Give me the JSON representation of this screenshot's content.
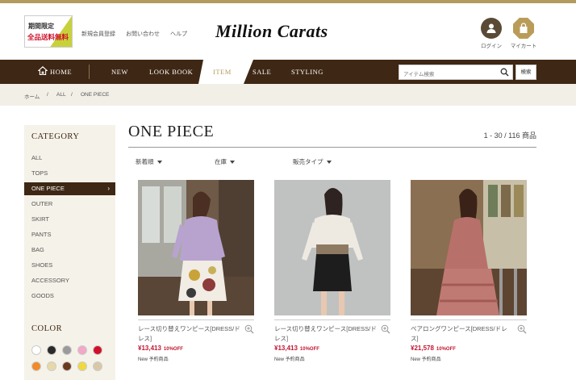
{
  "header": {
    "promo_line1": "期間限定",
    "promo_line2": "全品送料無料",
    "links": [
      "新規会員登録",
      "お問い合わせ",
      "ヘルプ"
    ],
    "logo": "Million Carats",
    "login_label": "ログイン",
    "mycart_label": "マイカート"
  },
  "nav": {
    "items": [
      "HOME",
      "NEW",
      "LOOK BOOK",
      "ITEM",
      "SALE",
      "STYLING"
    ],
    "active": "ITEM",
    "search_placeholder": "アイテム検索",
    "search_button": "検索"
  },
  "breadcrumb": [
    "ホーム",
    "/",
    "ALL",
    "/",
    "ONE PIECE"
  ],
  "sidebar": {
    "category_title": "CATEGORY",
    "categories": [
      "ALL",
      "TOPS",
      "ONE PIECE",
      "OUTER",
      "SKIRT",
      "PANTS",
      "BAG",
      "SHOES",
      "ACCESSORY",
      "GOODS"
    ],
    "active_category": "ONE PIECE",
    "color_title": "COLOR",
    "colors": [
      "#ffffff",
      "#2a2a2a",
      "#9a9a9a",
      "#f2a8c8",
      "#d0102a",
      "#f08a2a",
      "#e8d8a8",
      "#6b3a1e",
      "#f0d840",
      "#d8c8a8"
    ]
  },
  "main": {
    "title": "ONE PIECE",
    "count": "1 - 30 / 116 商品",
    "filters": [
      "新着順",
      "在庫",
      "販売タイプ"
    ]
  },
  "products": [
    {
      "name": "レース切り替えワンピース[DRESS/ドレス]",
      "price": "¥13,413",
      "discount": "10%OFF",
      "badges": "New 予約商品"
    },
    {
      "name": "レース切り替えワンピース[DRESS/ドレス]",
      "price": "¥13,413",
      "discount": "10%OFF",
      "badges": "New 予約商品"
    },
    {
      "name": "ベアロングワンピース[DRESS/ドレス]",
      "price": "¥21,578",
      "discount": "10%OFF",
      "badges": "New 予約商品"
    }
  ]
}
